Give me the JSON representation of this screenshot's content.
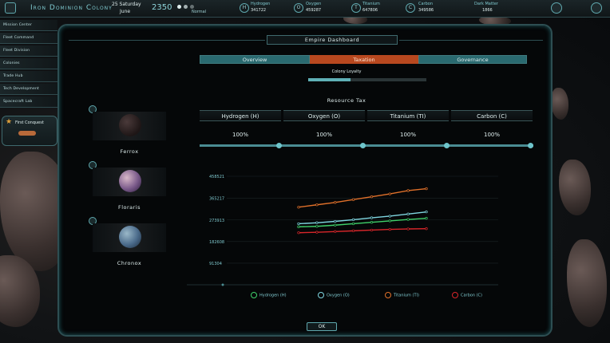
{
  "topbar": {
    "colony_title": "Iron Dominion Colony",
    "date_line1": "25 Saturday",
    "date_line2": "June",
    "year": "2350",
    "speed": "Normal",
    "resources": [
      {
        "icon": "H",
        "name": "Hydrogen",
        "value": "341722"
      },
      {
        "icon": "O",
        "name": "Oxygen",
        "value": "459287"
      },
      {
        "icon": "T",
        "name": "Titanium",
        "value": "647806"
      },
      {
        "icon": "C",
        "name": "Carbon",
        "value": "349586"
      }
    ],
    "dark_matter": {
      "name": "Dark Matter",
      "value": "1866"
    }
  },
  "sidebar": {
    "items": [
      {
        "label": "Mission Center"
      },
      {
        "label": "Fleet Command"
      },
      {
        "label": "Fleet Division"
      },
      {
        "label": "Colonies"
      },
      {
        "label": "Trade Hub"
      },
      {
        "label": "Tech Development"
      },
      {
        "label": "Spacecraft Lab"
      }
    ],
    "conquest_label": "First Conquest"
  },
  "dialog": {
    "title": "Empire Dashboard",
    "tabs": [
      {
        "label": "Overview",
        "active": false
      },
      {
        "label": "Taxation",
        "active": true
      },
      {
        "label": "Governance",
        "active": false
      }
    ],
    "loyalty_label": "Colony Loyalty",
    "loyalty_level": 0.36,
    "tax_title": "Resource Tax",
    "tax_columns": [
      {
        "name": "Hydrogen (H)",
        "value": "100%"
      },
      {
        "name": "Oxygen (O)",
        "value": "100%"
      },
      {
        "name": "Titanium (TI)",
        "value": "100%"
      },
      {
        "name": "Carbon (C)",
        "value": "100%"
      }
    ],
    "planets": [
      {
        "name": "Ferrox"
      },
      {
        "name": "Floraris"
      },
      {
        "name": "Chronox"
      }
    ],
    "ok_label": "OK"
  },
  "colors": {
    "hydrogen": "#3fd16a",
    "oxygen": "#7fd6e0",
    "titanium": "#e0702a",
    "carbon": "#d8262a",
    "accent": "#5fb0b6",
    "active_tab": "#b8481f"
  },
  "chart_data": {
    "type": "line",
    "y_ticks": [
      "458521",
      "365217",
      "273913",
      "182608",
      "91304"
    ],
    "ylim": [
      0,
      458521
    ],
    "x": [
      1,
      2,
      3,
      4,
      5,
      6,
      7,
      8
    ],
    "series": [
      {
        "name": "Hydrogen (H)",
        "color": "#3fd16a",
        "values": [
          245000,
          247000,
          252000,
          258000,
          264000,
          270000,
          276000,
          281000
        ]
      },
      {
        "name": "Oxygen (O)",
        "color": "#7fd6e0",
        "values": [
          258000,
          262000,
          268000,
          275000,
          283000,
          290000,
          299000,
          308000
        ]
      },
      {
        "name": "Titanium (TI)",
        "color": "#e0702a",
        "values": [
          328000,
          338000,
          348000,
          360000,
          372000,
          384000,
          398000,
          406000
        ]
      },
      {
        "name": "Carbon (C)",
        "color": "#d8262a",
        "values": [
          220000,
          222000,
          225000,
          228000,
          231000,
          234000,
          236000,
          237000
        ]
      }
    ]
  }
}
